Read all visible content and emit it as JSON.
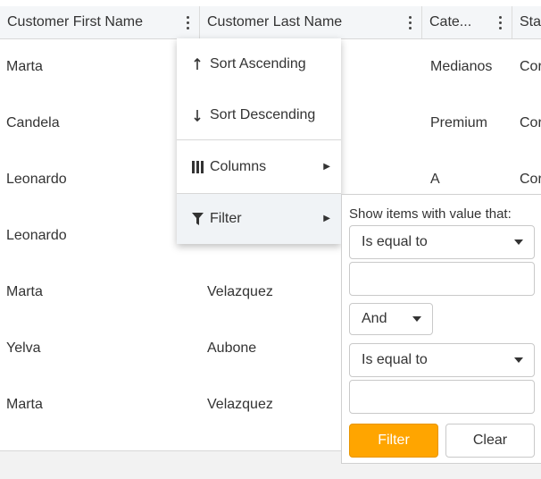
{
  "columns": [
    {
      "label": "Customer First Name"
    },
    {
      "label": "Customer Last Name"
    },
    {
      "label": "Cate..."
    },
    {
      "label": "Sta"
    }
  ],
  "rows": [
    {
      "first": "Marta",
      "last": "",
      "category": "Medianos",
      "status": "Cor"
    },
    {
      "first": "Candela",
      "last": "",
      "category": "Premium",
      "status": "Cor"
    },
    {
      "first": "Leonardo",
      "last": "",
      "category": "A",
      "status": "Cor"
    },
    {
      "first": "Leonardo",
      "last": "",
      "category": "",
      "status": ""
    },
    {
      "first": "Marta",
      "last": "Velazquez",
      "category": "",
      "status": ""
    },
    {
      "first": "Yelva",
      "last": "Aubone",
      "category": "",
      "status": ""
    },
    {
      "first": "Marta",
      "last": "Velazquez",
      "category": "",
      "status": ""
    }
  ],
  "menu": {
    "sort_asc": "Sort Ascending",
    "sort_desc": "Sort Descending",
    "columns": "Columns",
    "filter": "Filter"
  },
  "filter_panel": {
    "title": "Show items with value that:",
    "operator1": "Is equal to",
    "value1": "",
    "logic": "And",
    "operator2": "Is equal to",
    "value2": "",
    "filter_button": "Filter",
    "clear_button": "Clear"
  },
  "colors": {
    "accent": "#ffa500",
    "header_bg": "#f4f6f8",
    "hover_bg": "#f0f3f6"
  }
}
